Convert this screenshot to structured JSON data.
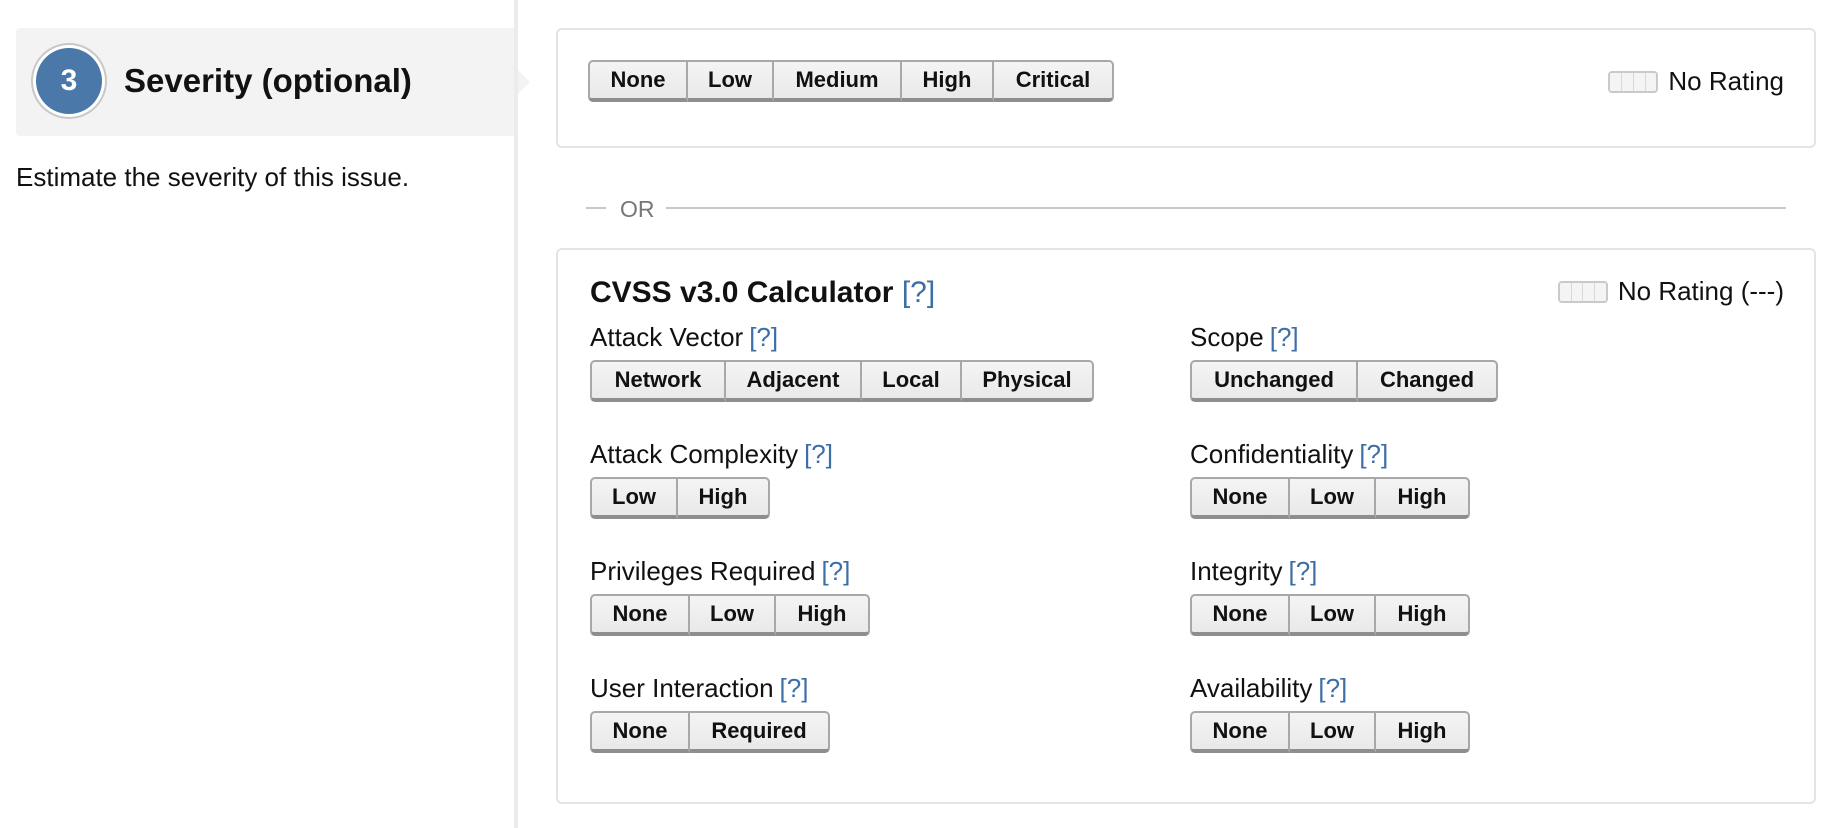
{
  "step": {
    "number": "3",
    "title": "Severity (optional)",
    "description": "Estimate the severity of this issue."
  },
  "severity": {
    "options": [
      "None",
      "Low",
      "Medium",
      "High",
      "Critical"
    ],
    "rating_label": "No Rating"
  },
  "divider": {
    "label": "OR"
  },
  "cvss": {
    "title": "CVSS v3.0 Calculator",
    "help": "[?]",
    "rating_label": "No Rating (---)",
    "metrics": {
      "attack_vector": {
        "label": "Attack Vector",
        "help": "[?]",
        "options": [
          "Network",
          "Adjacent",
          "Local",
          "Physical"
        ]
      },
      "attack_complexity": {
        "label": "Attack Complexity",
        "help": "[?]",
        "options": [
          "Low",
          "High"
        ]
      },
      "privileges_required": {
        "label": "Privileges Required",
        "help": "[?]",
        "options": [
          "None",
          "Low",
          "High"
        ]
      },
      "user_interaction": {
        "label": "User Interaction",
        "help": "[?]",
        "options": [
          "None",
          "Required"
        ]
      },
      "scope": {
        "label": "Scope",
        "help": "[?]",
        "options": [
          "Unchanged",
          "Changed"
        ]
      },
      "confidentiality": {
        "label": "Confidentiality",
        "help": "[?]",
        "options": [
          "None",
          "Low",
          "High"
        ]
      },
      "integrity": {
        "label": "Integrity",
        "help": "[?]",
        "options": [
          "None",
          "Low",
          "High"
        ]
      },
      "availability": {
        "label": "Availability",
        "help": "[?]",
        "options": [
          "None",
          "Low",
          "High"
        ]
      }
    }
  },
  "colors": {
    "accent": "#4a78a8",
    "link": "#3d6ea6",
    "panel_border": "#e4e4e4",
    "header_bg": "#f3f3f3"
  }
}
